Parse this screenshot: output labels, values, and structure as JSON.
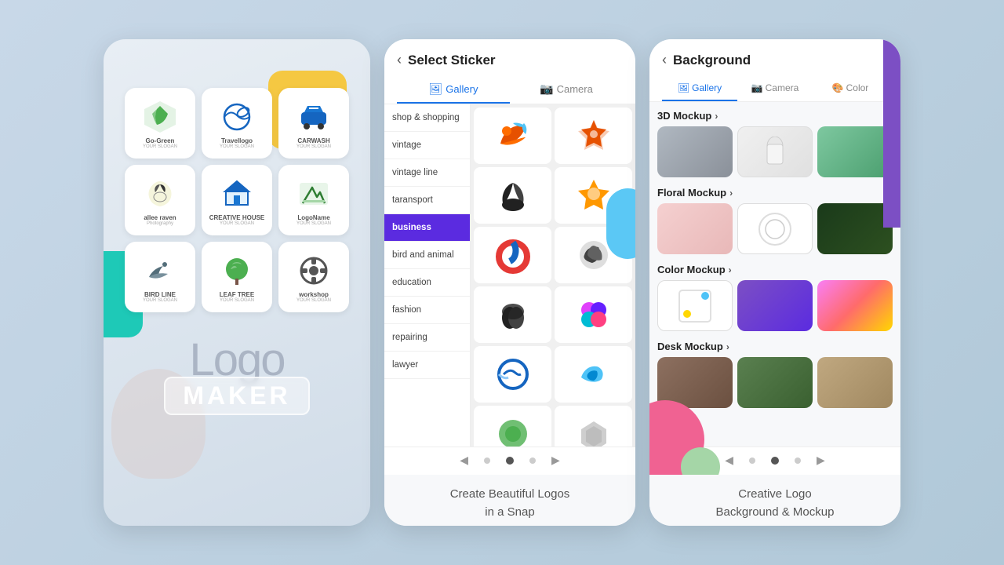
{
  "card1": {
    "logo_word": "Logo",
    "maker_word": "MAKER",
    "logos": [
      {
        "name": "Go-Green",
        "sublabel": "YOUR SLOGAN"
      },
      {
        "name": "Travellogo",
        "sublabel": "YOUR SLOGAN"
      },
      {
        "name": "CARWASH",
        "sublabel": "YOUR SLOGAN"
      },
      {
        "name": "allee raven",
        "sublabel": "Photography"
      },
      {
        "name": "CREATIVE HOUSE",
        "sublabel": "YOUR SLOGAN"
      },
      {
        "name": "LogoName",
        "sublabel": "YOUR SLOGAN"
      },
      {
        "name": "BIRD LINE",
        "sublabel": "YOUR SLOGAN"
      },
      {
        "name": "LEAF TREE",
        "sublabel": "YOUR SLOGAN"
      },
      {
        "name": "workshop",
        "sublabel": "YOUR SLOGAN"
      }
    ]
  },
  "card2": {
    "title": "Select Sticker",
    "back_icon": "‹",
    "tabs": [
      {
        "label": "Gallery",
        "icon": "🖼",
        "active": true
      },
      {
        "label": "Camera",
        "icon": "📷",
        "active": false
      }
    ],
    "categories": [
      {
        "label": "shop & shopping",
        "active": false
      },
      {
        "label": "vintage",
        "active": false
      },
      {
        "label": "vintage line",
        "active": false
      },
      {
        "label": "taransport",
        "active": false
      },
      {
        "label": "business",
        "active": true
      },
      {
        "label": "bird and animal",
        "active": false
      },
      {
        "label": "education",
        "active": false
      },
      {
        "label": "fashion",
        "active": false
      },
      {
        "label": "repairing",
        "active": false
      },
      {
        "label": "lawyer",
        "active": false
      }
    ],
    "caption_line1": "Create Beautiful Logos",
    "caption_line2": "in a Snap"
  },
  "card3": {
    "back_icon": "‹",
    "title": "Background",
    "tabs": [
      {
        "label": "Gallery",
        "icon": "🖼",
        "active": true
      },
      {
        "label": "Camera",
        "icon": "📷",
        "active": false
      },
      {
        "label": "Color",
        "icon": "🎨",
        "active": false
      }
    ],
    "sections": [
      {
        "label": "3D Mockup",
        "thumbs": [
          "thumb-gray",
          "thumb-white",
          "thumb-green"
        ]
      },
      {
        "label": "Floral Mockup",
        "thumbs": [
          "thumb-pink-floral",
          "thumb-white-circle",
          "thumb-dark-green"
        ]
      },
      {
        "label": "Color Mockup",
        "thumbs": [
          "thumb-white-sq",
          "thumb-purple",
          "thumb-gradient"
        ]
      },
      {
        "label": "Desk Mockup",
        "thumbs": [
          "thumb-desk1",
          "thumb-desk2",
          "thumb-desk3"
        ]
      }
    ],
    "caption_line1": "Creative Logo",
    "caption_line2": "Background & Mockup"
  }
}
